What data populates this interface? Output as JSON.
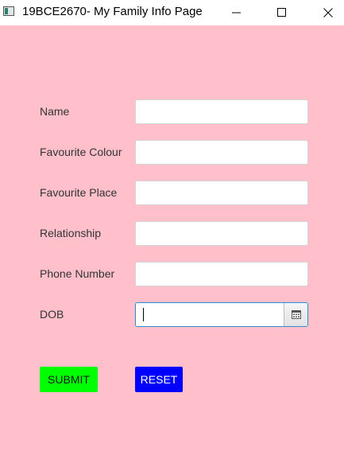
{
  "window": {
    "title": "19BCE2670- My Family Info Page"
  },
  "form": {
    "fields": [
      {
        "label": "Name",
        "value": "",
        "placeholder": ""
      },
      {
        "label": "Favourite Colour",
        "value": "",
        "placeholder": ""
      },
      {
        "label": "Favourite Place",
        "value": "",
        "placeholder": ""
      },
      {
        "label": "Relationship",
        "value": "",
        "placeholder": ""
      },
      {
        "label": "Phone Number",
        "value": "",
        "placeholder": ""
      }
    ],
    "dob": {
      "label": "DOB",
      "value": "",
      "icon": "calendar-icon"
    }
  },
  "actions": {
    "submit": {
      "label": "SUBMIT",
      "bg": "#00ff00",
      "fg": "#1a1a1a"
    },
    "reset": {
      "label": "RESET",
      "bg": "#0000ff",
      "fg": "#ffffff"
    }
  },
  "colors": {
    "background": "#ffc0cb",
    "focus_border": "#2a8fd4"
  }
}
